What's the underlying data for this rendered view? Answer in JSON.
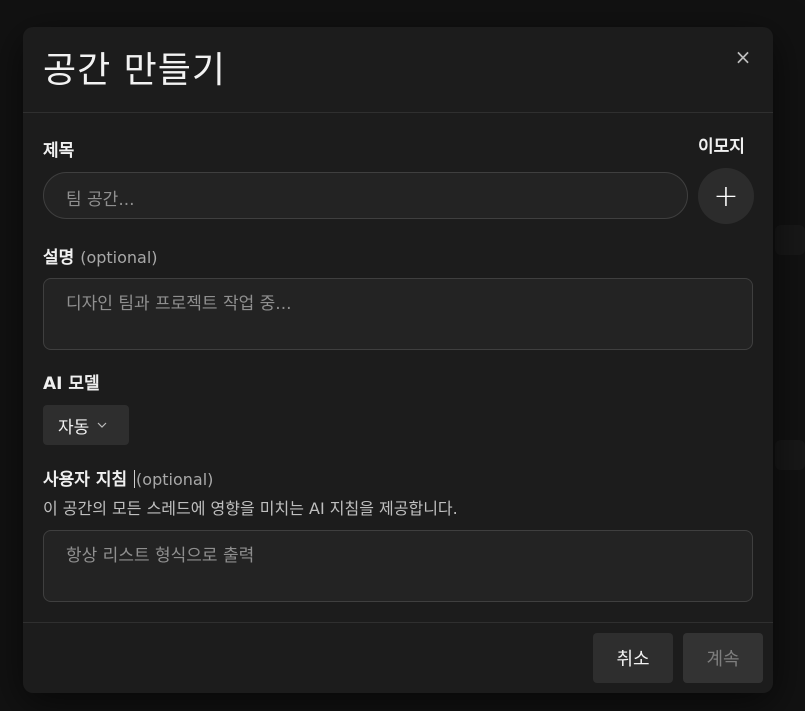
{
  "modal": {
    "title": "공간 만들기",
    "close_icon": "×"
  },
  "form": {
    "title_label": "제목",
    "title_placeholder": "팀 공간...",
    "emoji_label": "이모지",
    "emoji_add_icon": "+",
    "description_label": "설명",
    "description_optional": "(optional)",
    "description_placeholder": "디자인 팀과 프로젝트 작업 중...",
    "model_label": "AI 모델",
    "model_value": "자동",
    "instructions_label": "사용자 지침",
    "instructions_optional": "(optional)",
    "instructions_helper": "이 공간의 모든 스레드에 영향을 미치는 AI 지침을 제공합니다.",
    "instructions_placeholder": "항상 리스트 형식으로 출력"
  },
  "footer": {
    "cancel_label": "취소",
    "continue_label": "계속"
  }
}
